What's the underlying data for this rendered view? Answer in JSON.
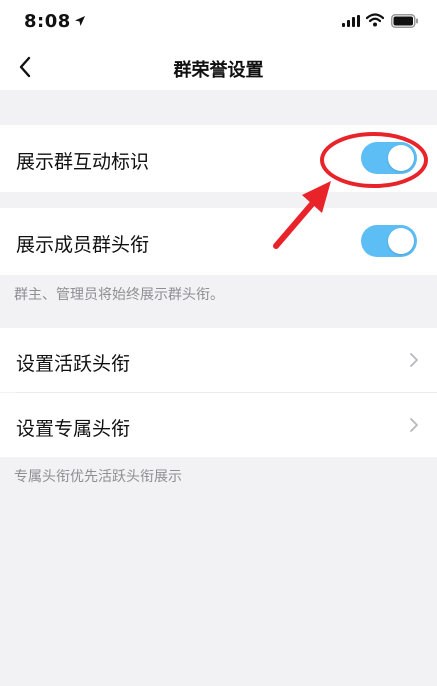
{
  "status_bar": {
    "time": "8:08",
    "icons": [
      "location-arrow-icon",
      "signal-icon",
      "wifi-icon",
      "battery-icon"
    ]
  },
  "nav": {
    "title": "群荣誉设置",
    "back_icon": "chevron-left-icon"
  },
  "settings": {
    "show_interaction_badge": {
      "label": "展示群互动标识",
      "enabled": true
    },
    "show_member_title": {
      "label": "展示成员群头衔",
      "enabled": true
    },
    "title_hint": "群主、管理员将始终展示群头衔。",
    "set_active_title": {
      "label": "设置活跃头衔"
    },
    "set_exclusive_title": {
      "label": "设置专属头衔"
    },
    "exclusive_hint": "专属头衔优先活跃头衔展示"
  },
  "colors": {
    "toggle_on": "#5dbdf5",
    "annotation_red": "#e8242a",
    "background": "#f2f2f5"
  }
}
